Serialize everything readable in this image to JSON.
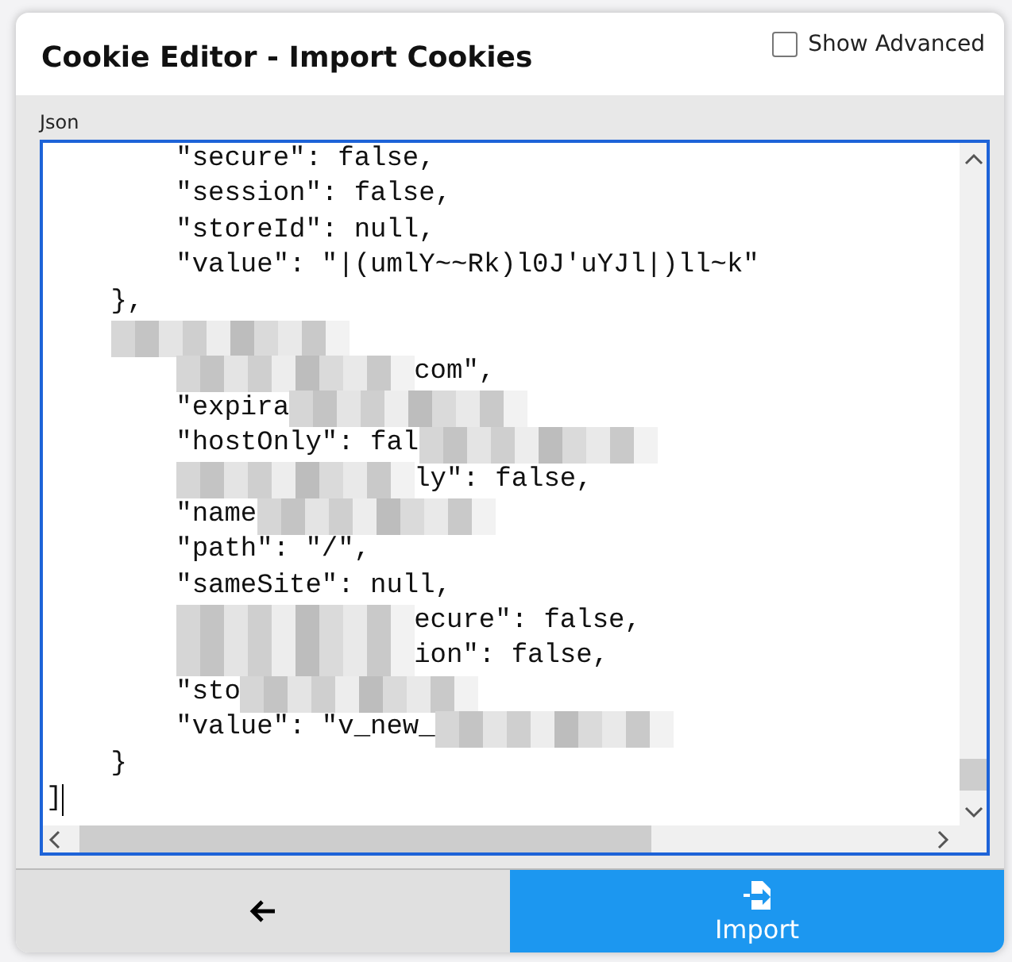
{
  "dialog": {
    "title": "Cookie Editor - Import Cookies",
    "show_advanced": {
      "label": "Show Advanced",
      "checked": false
    }
  },
  "editor": {
    "label": "Json",
    "lines": [
      {
        "segments": [
          {
            "kind": "text",
            "text": "        \"secure\": false,"
          }
        ]
      },
      {
        "segments": [
          {
            "kind": "text",
            "text": "        \"session\": false,"
          }
        ]
      },
      {
        "segments": [
          {
            "kind": "text",
            "text": "        \"storeId\": null,"
          }
        ]
      },
      {
        "segments": [
          {
            "kind": "text",
            "text": "        \"value\": \"|(umlY~~Rk)l0J'uYJl|)ll~k\""
          }
        ]
      },
      {
        "segments": [
          {
            "kind": "text",
            "text": "    },"
          }
        ]
      },
      {
        "segments": [
          {
            "kind": "mosaic_outer"
          }
        ]
      },
      {
        "segments": [
          {
            "kind": "mosaic"
          },
          {
            "kind": "text",
            "text": "com\","
          }
        ]
      },
      {
        "segments": [
          {
            "kind": "text",
            "text": "        \"expira"
          },
          {
            "kind": "mosaic"
          }
        ]
      },
      {
        "segments": [
          {
            "kind": "text",
            "text": "        \"hostOnly\": fal"
          },
          {
            "kind": "mosaic"
          }
        ]
      },
      {
        "segments": [
          {
            "kind": "mosaic"
          },
          {
            "kind": "text",
            "text": "ly\": false,"
          }
        ]
      },
      {
        "segments": [
          {
            "kind": "text",
            "text": "        \"name"
          },
          {
            "kind": "mosaic"
          }
        ]
      },
      {
        "segments": [
          {
            "kind": "text",
            "text": "        \"path\": \"/\","
          }
        ]
      },
      {
        "segments": [
          {
            "kind": "text",
            "text": "        \"sameSite\": null,"
          }
        ]
      },
      {
        "segments": [
          {
            "kind": "mosaic"
          },
          {
            "kind": "text",
            "text": "ecure\": false,"
          }
        ]
      },
      {
        "segments": [
          {
            "kind": "mosaic"
          },
          {
            "kind": "text",
            "text": "ion\": false,"
          }
        ]
      },
      {
        "segments": [
          {
            "kind": "text",
            "text": "        \"sto"
          },
          {
            "kind": "mosaic"
          }
        ]
      },
      {
        "segments": [
          {
            "kind": "text",
            "text": "        \"value\": \"v_new_"
          },
          {
            "kind": "mosaic"
          }
        ]
      },
      {
        "segments": [
          {
            "kind": "text",
            "text": "    }"
          }
        ]
      },
      {
        "segments": [
          {
            "kind": "text",
            "text": "]"
          }
        ]
      }
    ]
  },
  "footer": {
    "import_button": {
      "label": "Import"
    }
  }
}
